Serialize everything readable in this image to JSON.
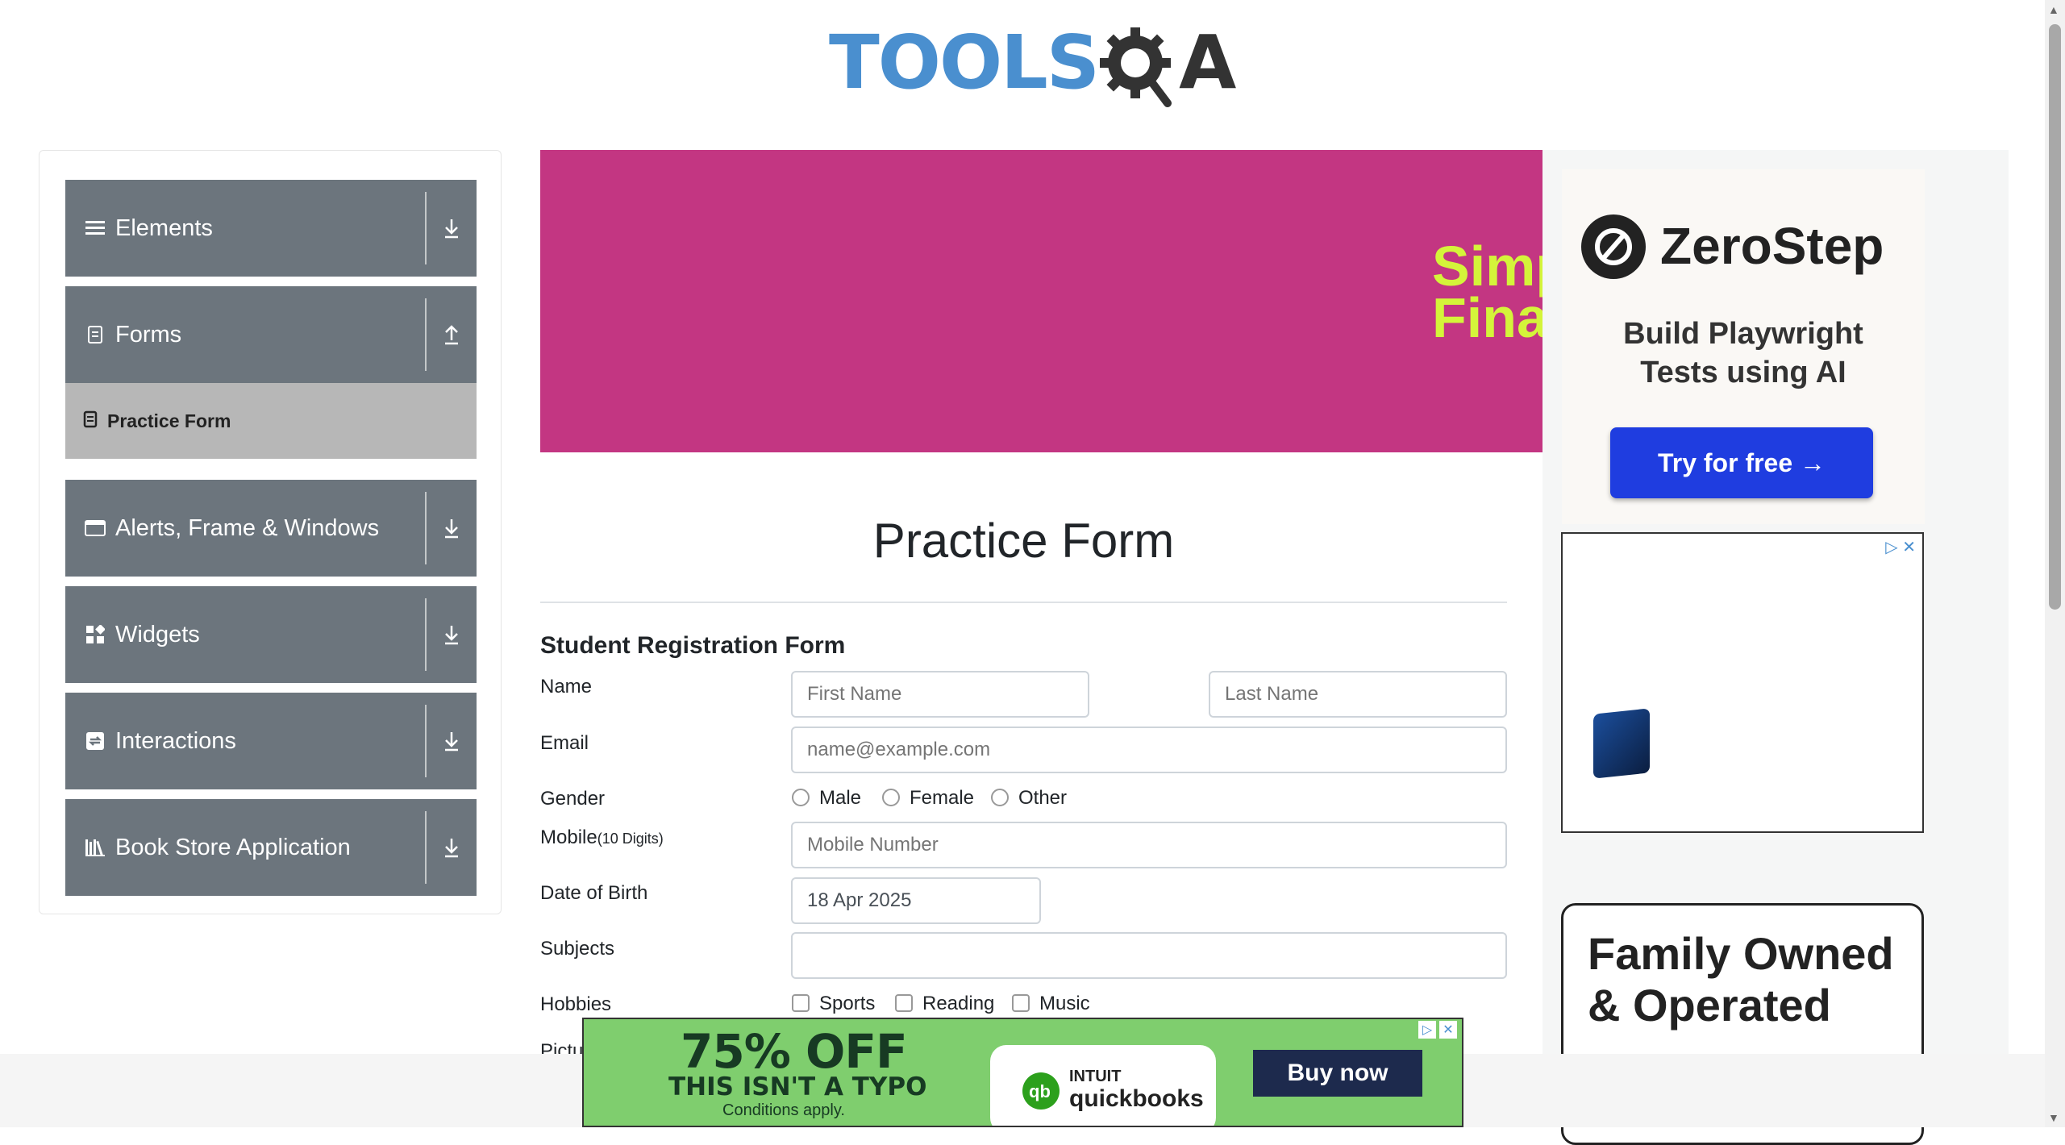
{
  "brand": {
    "logo_text_main": "TOOLS",
    "logo_text_a": "A",
    "logo_color": "#4a8fcf"
  },
  "sidebar": {
    "groups": [
      {
        "label": "Elements",
        "icon": "menu-icon"
      },
      {
        "label": "Forms",
        "icon": "document-icon",
        "expanded": true
      },
      {
        "label": "Alerts, Frame & Windows",
        "icon": "window-icon"
      },
      {
        "label": "Widgets",
        "icon": "widgets-icon"
      },
      {
        "label": "Interactions",
        "icon": "interactions-icon"
      },
      {
        "label": "Book Store Application",
        "icon": "library-icon"
      }
    ],
    "active_item": {
      "label": "Practice Form",
      "icon": "form-icon"
    }
  },
  "banner": {
    "text_line1": "Simp",
    "text_line2": "Fina",
    "bg_color": "#c33682",
    "text_color": "#d4f43a"
  },
  "form": {
    "title": "Practice Form",
    "subtitle": "Student Registration Form",
    "labels": {
      "name": "Name",
      "email": "Email",
      "gender": "Gender",
      "mobile": "Mobile",
      "mobile_hint": "(10 Digits)",
      "dob": "Date of Birth",
      "subjects": "Subjects",
      "hobbies": "Hobbies",
      "picture": "Pictu"
    },
    "placeholders": {
      "first_name": "First Name",
      "last_name": "Last Name",
      "email": "name@example.com",
      "mobile": "Mobile Number"
    },
    "values": {
      "dob": "18 Apr 2025",
      "subjects": ""
    },
    "gender_options": [
      "Male",
      "Female",
      "Other"
    ],
    "hobby_options": [
      "Sports",
      "Reading",
      "Music"
    ]
  },
  "ads": {
    "zerostep": {
      "name": "ZeroStep",
      "tagline_1": "Build Playwright",
      "tagline_2": "Tests using AI",
      "cta": "Try for free →",
      "cta_color": "#1f3de0"
    },
    "family": {
      "line1": "Family Owned",
      "line2": "& Operated"
    },
    "quickbooks": {
      "headline": "75% OFF",
      "subline": "THIS ISN'T A TYPO",
      "fineprint": "Conditions apply.",
      "brand_1": "INTUIT",
      "brand_2": "quickbooks",
      "cta": "Buy now",
      "bg_color": "#7fce6e"
    }
  }
}
